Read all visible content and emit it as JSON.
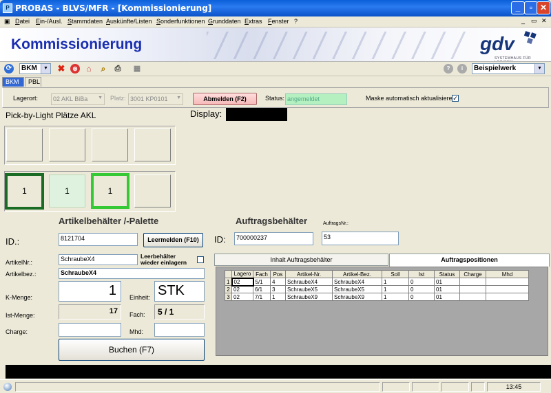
{
  "window": {
    "title": "PROBAS - BLVS/MFR - [Kommissionierung]",
    "icon": "app-icon"
  },
  "menu": [
    "Datei",
    "Ein-/Ausl.",
    "Stammdaten",
    "Auskünfte/Listen",
    "Sonderfunktionen",
    "Grunddaten",
    "Extras",
    "Fenster",
    "?"
  ],
  "banner": {
    "title": "Kommissionierung",
    "logo": "gdv",
    "logo_sub": "SYSTEMHAUS FÜR LOGISTIK"
  },
  "toolbar": {
    "mode_select": "BKM",
    "werk_select": "Beispielwerk"
  },
  "tabs": [
    "BKM",
    "PBL"
  ],
  "strip": {
    "lagerort_label": "Lagerort:",
    "lagerort_value": "02 AKL BiBa",
    "platz_label": "Platz:",
    "platz_value": "3001 KP0101",
    "abmelden_button": "Abmelden (F2)",
    "status_label": "Status:",
    "status_value": "angemeldet",
    "auto_label": "Maske automatisch aktualisieren",
    "auto_checked": "✓"
  },
  "pick": {
    "title": "Pick-by-Light Plätze AKL",
    "display_label": "Display:",
    "slots": [
      "",
      "",
      "",
      "",
      "1",
      "1",
      "1",
      ""
    ]
  },
  "artikel": {
    "title": "Artikelbehälter /-Palette",
    "id_label": "ID.:",
    "id_value": "8121704",
    "leermelden_button": "Leermelden (F10)",
    "artikelnr_label": "ArtikelNr.:",
    "artikelnr_value": "SchraubeX4",
    "leerbehaelter_label": "Leerbehälter wieder einlagern",
    "artikelbez_label": "Artikelbez.:",
    "artikelbez_value": "SchraubeX4",
    "kmenge_label": "K-Menge:",
    "kmenge_value": "1",
    "einheit_label": "Einheit:",
    "einheit_value": "STK",
    "istmenge_label": "Ist-Menge:",
    "istmenge_value": "17",
    "fach_label": "Fach:",
    "fach_value": "5 / 1",
    "charge_label": "Charge:",
    "mhd_label": "Mhd:",
    "buchen_button": "Buchen (F7)"
  },
  "auftrag": {
    "title": "Auftragsbehälter",
    "id_label": "ID:",
    "id_value": "700000237",
    "nr_label": "AuftragsNr.:",
    "nr_value": "53",
    "tab_inhalt": "Inhalt Auftragsbehälter",
    "tab_positionen": "Auftragspositionen",
    "columns": [
      "Lagero",
      "Fach",
      "Pos",
      "Artikel-Nr.",
      "Artikel-Bez.",
      "Soll",
      "Ist",
      "Status",
      "Charge",
      "Mhd"
    ],
    "rows": [
      {
        "n": "1",
        "cells": [
          "02",
          "5/1",
          "4",
          "SchraubeX4",
          "SchraubeX4",
          "1",
          "0",
          "01",
          "",
          ""
        ]
      },
      {
        "n": "2",
        "cells": [
          "02",
          "6/1",
          "3",
          "SchraubeX5",
          "SchraubeX5",
          "1",
          "0",
          "01",
          "",
          ""
        ]
      },
      {
        "n": "3",
        "cells": [
          "02",
          "7/1",
          "1",
          "SchraubeX9",
          "SchraubeX9",
          "1",
          "0",
          "01",
          "",
          ""
        ]
      }
    ]
  },
  "statusbar": {
    "time": "13:45"
  }
}
